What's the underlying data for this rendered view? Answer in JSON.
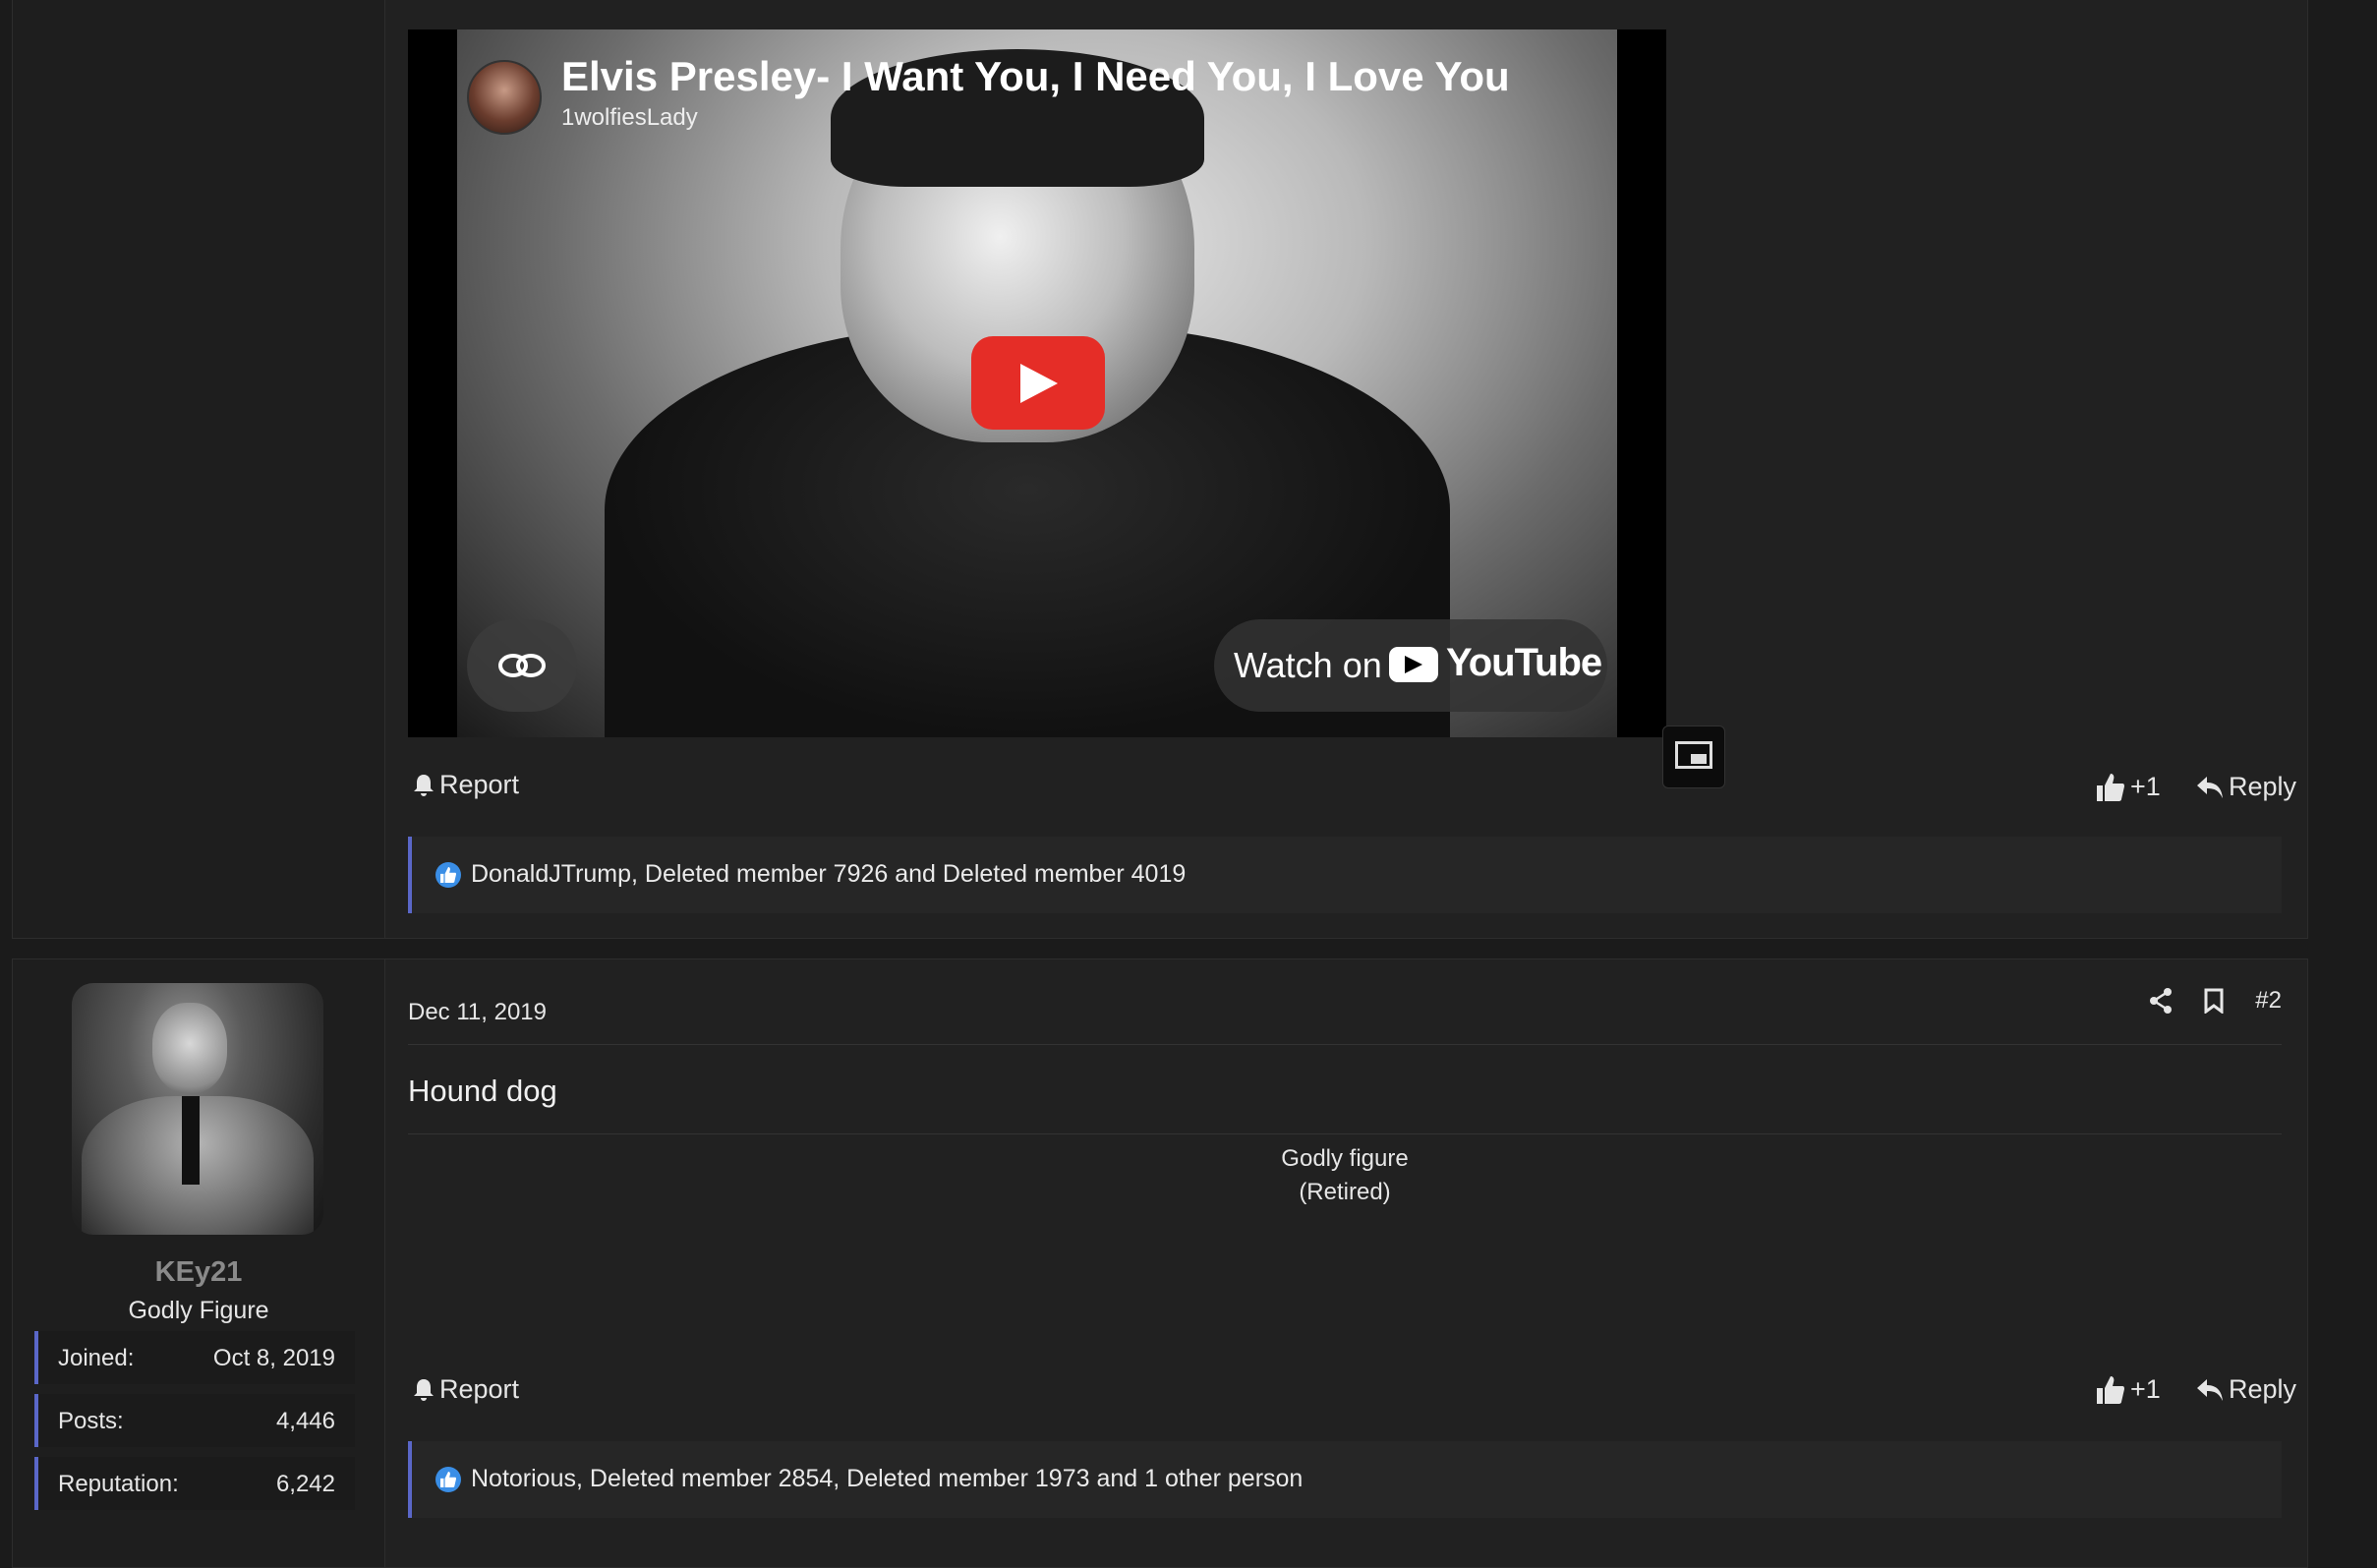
{
  "post1": {
    "video": {
      "title": "Elvis Presley- I Want You, I Need You, I Love You",
      "channel": "1wolfiesLady",
      "watch_on": "Watch on",
      "youtube": "YouTube"
    },
    "report_label": "Report",
    "plus_one": "+1",
    "reply_label": "Reply",
    "reactions_text": "DonaldJTrump, Deleted member 7926 and Deleted member 4019"
  },
  "post2": {
    "user": {
      "username": "KEy21",
      "title": "Godly Figure",
      "stats": [
        {
          "label": "Joined:",
          "value": "Oct 8, 2019"
        },
        {
          "label": "Posts:",
          "value": "4,446"
        },
        {
          "label": "Reputation:",
          "value": "6,242"
        }
      ]
    },
    "date": "Dec 11, 2019",
    "post_number": "#2",
    "body": "Hound dog",
    "signature_line1": "Godly figure",
    "signature_line2": "(Retired)",
    "report_label": "Report",
    "plus_one": "+1",
    "reply_label": "Reply",
    "reactions_text": "Notorious, Deleted member 2854, Deleted member 1973 and 1 other person"
  },
  "colors": {
    "accent": "#5a67c8",
    "youtube_red": "#e52d27",
    "like_blue": "#3a8ee6",
    "background": "#1b1b1b"
  }
}
